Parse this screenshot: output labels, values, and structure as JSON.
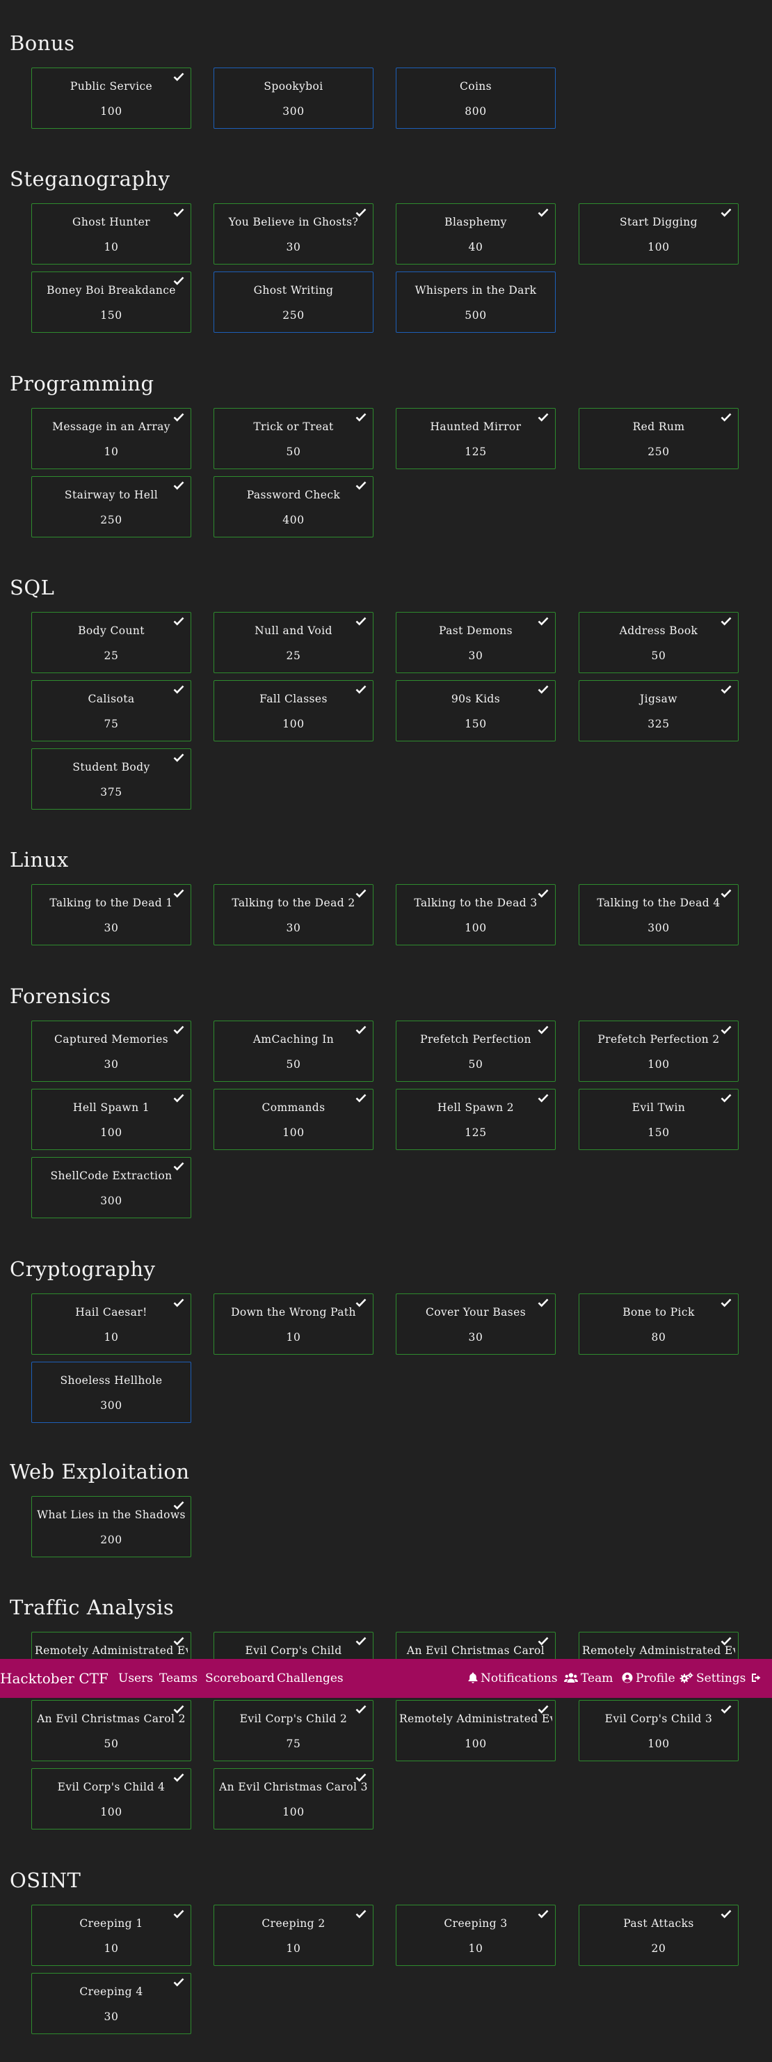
{
  "navbar": {
    "brand": "Hacktober CTF",
    "left_links": [
      "Users",
      "Teams",
      "Scoreboard",
      "Challenges"
    ],
    "right_links": [
      {
        "label": "Notifications",
        "icon": "bell-icon"
      },
      {
        "label": "Team",
        "icon": "users-icon"
      },
      {
        "label": "Profile",
        "icon": "user-circle-icon"
      },
      {
        "label": "Settings",
        "icon": "cogs-icon"
      },
      {
        "label": "",
        "icon": "sign-out-icon"
      }
    ]
  },
  "colors": {
    "background": "#212121",
    "solved_border": "#2e8b2e",
    "unsolved_border": "#1d5fb8",
    "navbar": "#a00a5c"
  },
  "categories": [
    {
      "name": "Bonus",
      "challenges": [
        {
          "name": "Public Service",
          "value": "100",
          "solved": true
        },
        {
          "name": "Spookyboi",
          "value": "300",
          "solved": false
        },
        {
          "name": "Coins",
          "value": "800",
          "solved": false
        }
      ]
    },
    {
      "name": "Steganography",
      "challenges": [
        {
          "name": "Ghost Hunter",
          "value": "10",
          "solved": true
        },
        {
          "name": "You Believe in Ghosts?",
          "value": "30",
          "solved": true
        },
        {
          "name": "Blasphemy",
          "value": "40",
          "solved": true
        },
        {
          "name": "Start Digging",
          "value": "100",
          "solved": true
        },
        {
          "name": "Boney Boi Breakdance",
          "value": "150",
          "solved": true
        },
        {
          "name": "Ghost Writing",
          "value": "250",
          "solved": false
        },
        {
          "name": "Whispers in the Dark",
          "value": "500",
          "solved": false
        }
      ]
    },
    {
      "name": "Programming",
      "challenges": [
        {
          "name": "Message in an Array",
          "value": "10",
          "solved": true
        },
        {
          "name": "Trick or Treat",
          "value": "50",
          "solved": true
        },
        {
          "name": "Haunted Mirror",
          "value": "125",
          "solved": true
        },
        {
          "name": "Red Rum",
          "value": "250",
          "solved": true
        },
        {
          "name": "Stairway to Hell",
          "value": "250",
          "solved": true
        },
        {
          "name": "Password Check",
          "value": "400",
          "solved": true
        }
      ]
    },
    {
      "name": "SQL",
      "challenges": [
        {
          "name": "Body Count",
          "value": "25",
          "solved": true
        },
        {
          "name": "Null and Void",
          "value": "25",
          "solved": true
        },
        {
          "name": "Past Demons",
          "value": "30",
          "solved": true
        },
        {
          "name": "Address Book",
          "value": "50",
          "solved": true
        },
        {
          "name": "Calisota",
          "value": "75",
          "solved": true
        },
        {
          "name": "Fall Classes",
          "value": "100",
          "solved": true
        },
        {
          "name": "90s Kids",
          "value": "150",
          "solved": true
        },
        {
          "name": "Jigsaw",
          "value": "325",
          "solved": true
        },
        {
          "name": "Student Body",
          "value": "375",
          "solved": true
        }
      ]
    },
    {
      "name": "Linux",
      "challenges": [
        {
          "name": "Talking to the Dead 1",
          "value": "30",
          "solved": true
        },
        {
          "name": "Talking to the Dead 2",
          "value": "30",
          "solved": true
        },
        {
          "name": "Talking to the Dead 3",
          "value": "100",
          "solved": true
        },
        {
          "name": "Talking to the Dead 4",
          "value": "300",
          "solved": true
        }
      ]
    },
    {
      "name": "Forensics",
      "challenges": [
        {
          "name": "Captured Memories",
          "value": "30",
          "solved": true
        },
        {
          "name": "AmCaching In",
          "value": "50",
          "solved": true
        },
        {
          "name": "Prefetch Perfection",
          "value": "50",
          "solved": true
        },
        {
          "name": "Prefetch Perfection 2",
          "value": "100",
          "solved": true
        },
        {
          "name": "Hell Spawn 1",
          "value": "100",
          "solved": true
        },
        {
          "name": "Commands",
          "value": "100",
          "solved": true
        },
        {
          "name": "Hell Spawn 2",
          "value": "125",
          "solved": true
        },
        {
          "name": "Evil Twin",
          "value": "150",
          "solved": true
        },
        {
          "name": "ShellCode Extraction",
          "value": "300",
          "solved": true
        }
      ]
    },
    {
      "name": "Cryptography",
      "challenges": [
        {
          "name": "Hail Caesar!",
          "value": "10",
          "solved": true
        },
        {
          "name": "Down the Wrong Path",
          "value": "10",
          "solved": true
        },
        {
          "name": "Cover Your Bases",
          "value": "30",
          "solved": true
        },
        {
          "name": "Bone to Pick",
          "value": "80",
          "solved": true
        },
        {
          "name": "Shoeless Hellhole",
          "value": "300",
          "solved": false
        }
      ]
    },
    {
      "name": "Web Exploitation",
      "challenges": [
        {
          "name": "What Lies in the Shadows",
          "value": "200",
          "solved": true
        }
      ]
    },
    {
      "name": "Traffic Analysis",
      "challenges": [
        {
          "name": "Remotely Administrated Ev",
          "value": "",
          "solved": true
        },
        {
          "name": "Evil Corp's Child",
          "value": "",
          "solved": true
        },
        {
          "name": "An Evil Christmas Carol",
          "value": "",
          "solved": true
        },
        {
          "name": "Remotely Administrated Ev",
          "value": "",
          "solved": true
        },
        {
          "name": "An Evil Christmas Carol 2",
          "value": "50",
          "solved": true
        },
        {
          "name": "Evil Corp's Child 2",
          "value": "75",
          "solved": true
        },
        {
          "name": "Remotely Administrated Ev",
          "value": "100",
          "solved": true
        },
        {
          "name": "Evil Corp's Child 3",
          "value": "100",
          "solved": true
        },
        {
          "name": "Evil Corp's Child 4",
          "value": "100",
          "solved": true
        },
        {
          "name": "An Evil Christmas Carol 3",
          "value": "100",
          "solved": true
        }
      ]
    },
    {
      "name": "OSINT",
      "challenges": [
        {
          "name": "Creeping 1",
          "value": "10",
          "solved": true
        },
        {
          "name": "Creeping 2",
          "value": "10",
          "solved": true
        },
        {
          "name": "Creeping 3",
          "value": "10",
          "solved": true
        },
        {
          "name": "Past Attacks",
          "value": "20",
          "solved": true
        },
        {
          "name": "Creeping 4",
          "value": "30",
          "solved": true
        }
      ]
    }
  ]
}
